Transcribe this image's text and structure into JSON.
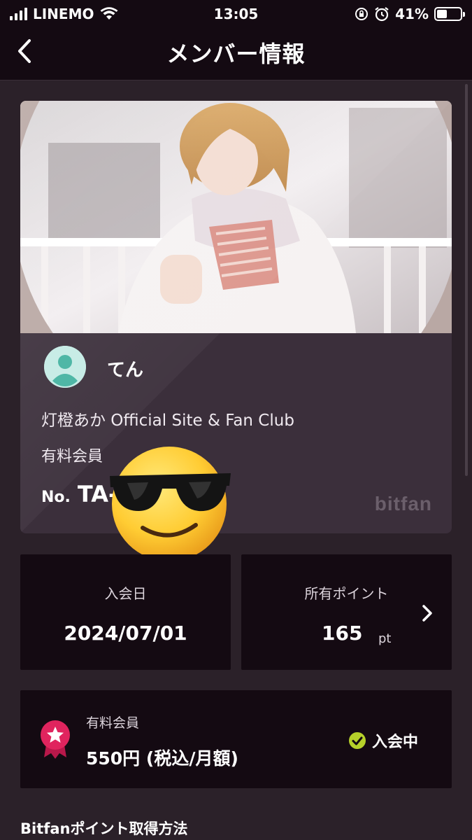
{
  "status_bar": {
    "carrier": "LINEMO",
    "time": "13:05",
    "battery": "41%"
  },
  "nav": {
    "title": "メンバー情報"
  },
  "card": {
    "member_name": "てん",
    "club_name": "灯橙あか Official Site & Fan Club",
    "member_type": "有料会員",
    "number_label": "No.",
    "number_value": "TA-",
    "logo_text": "bitfan"
  },
  "join": {
    "label": "入会日",
    "date": "2024/07/01"
  },
  "points": {
    "label": "所有ポイント",
    "value": "165",
    "unit": "pt"
  },
  "plan": {
    "label": "有料会員",
    "price": "550円 (税込/月額)",
    "status": "入会中"
  },
  "section": {
    "heading": "Bitfanポイント取得方法"
  },
  "colors": {
    "background": "#2b2129",
    "panel": "#140a12",
    "card": "#3b2f3b",
    "badge": "#e0245e",
    "check": "#b6d12a",
    "avatar": "#4fb7a6"
  }
}
